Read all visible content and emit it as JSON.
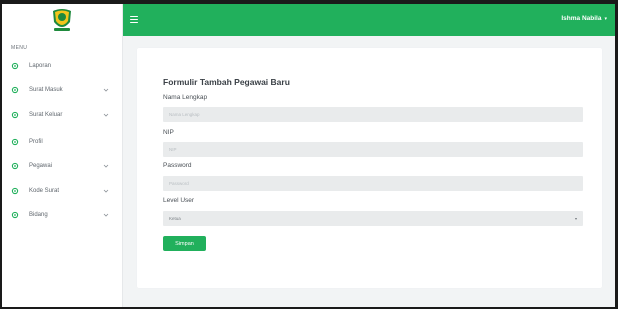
{
  "colors": {
    "accent": "#21b05c",
    "sidebar_bg": "#ffffff",
    "content_bg": "#f2f4f5",
    "input_bg": "#e9ebec"
  },
  "sidebar": {
    "logo_icon": "west-java-emblem",
    "menu_heading": "MENU",
    "items": [
      {
        "label": "Laporan",
        "icon": "gear-icon",
        "has_chevron": false
      },
      {
        "label": "Surat Masuk",
        "icon": "gear-icon",
        "has_chevron": true
      },
      {
        "label": "Surat Keluar",
        "icon": "gear-icon",
        "has_chevron": true
      },
      {
        "label": "Profil",
        "icon": "gear-icon",
        "has_chevron": false
      },
      {
        "label": "Pegawai",
        "icon": "gear-icon",
        "has_chevron": true
      },
      {
        "label": "Kode Surat",
        "icon": "gear-icon",
        "has_chevron": true
      },
      {
        "label": "Bidang",
        "icon": "gear-icon",
        "has_chevron": true
      }
    ]
  },
  "topbar": {
    "menu_icon": "hamburger-icon",
    "user_name": "Ishma Nabila",
    "user_caret": "▾"
  },
  "form": {
    "title": "Formulir Tambah Pegawai Baru",
    "fields": [
      {
        "label": "Nama Lengkap",
        "placeholder": "Nama Lengkap",
        "value": ""
      },
      {
        "label": "NIP",
        "placeholder": "NIP",
        "value": ""
      },
      {
        "label": "Password",
        "placeholder": "Password",
        "value": ""
      }
    ],
    "level": {
      "label": "Level User",
      "selected": "Ketua",
      "arrow": "▾"
    },
    "submit_label": "Simpan"
  }
}
